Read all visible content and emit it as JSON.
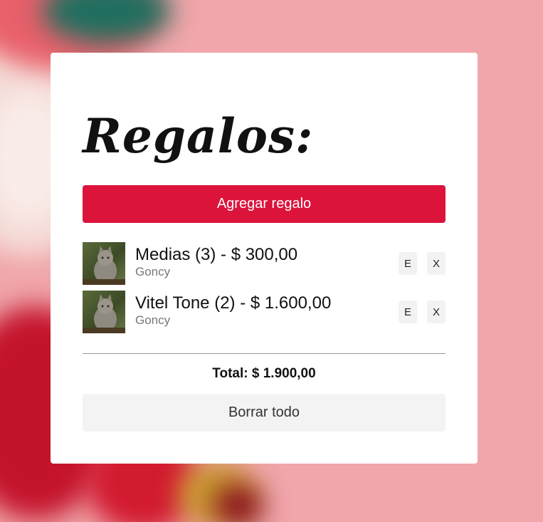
{
  "heading": "Regalos:",
  "add_button": "Agregar regalo",
  "gifts": [
    {
      "name": "Medias (3) - $ 300,00",
      "owner": "Goncy",
      "edit_label": "E",
      "delete_label": "X"
    },
    {
      "name": "Vitel Tone (2) - $ 1.600,00",
      "owner": "Goncy",
      "edit_label": "E",
      "delete_label": "X"
    }
  ],
  "total": "Total: $ 1.900,00",
  "clear_button": "Borrar todo",
  "colors": {
    "accent": "#dc143c",
    "card": "#ffffff",
    "background": "#f0a6aa"
  },
  "icons": {
    "thumbnail": "cat-photo"
  }
}
